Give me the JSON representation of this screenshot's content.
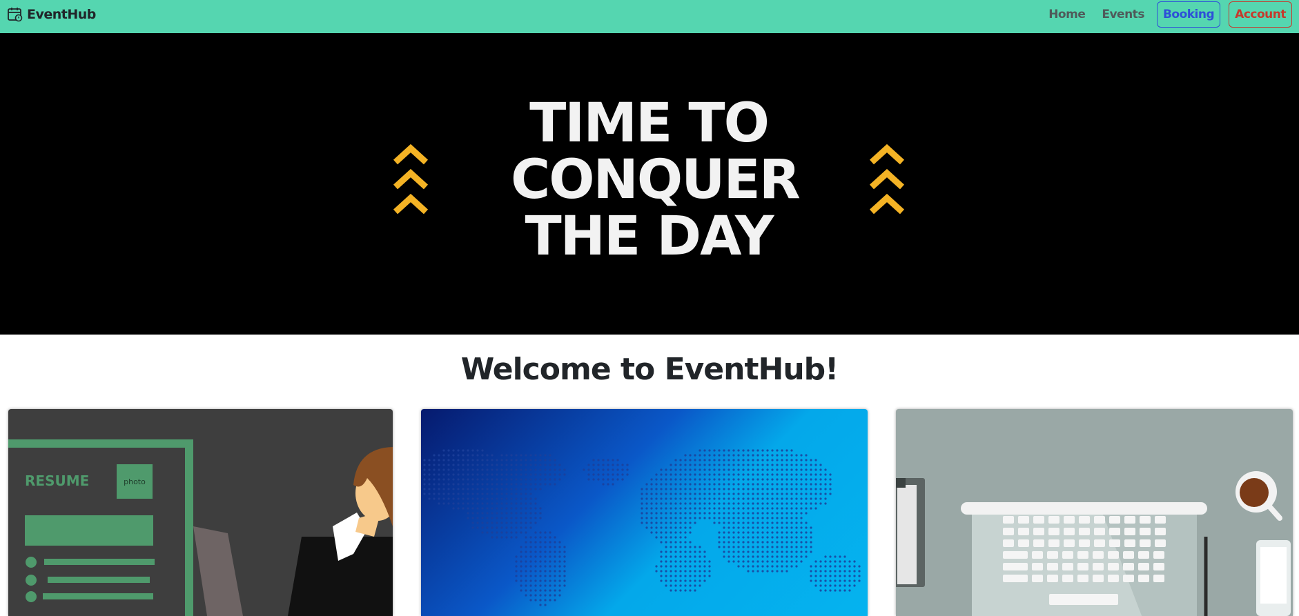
{
  "navbar": {
    "brand": "EventHub",
    "links": {
      "home": "Home",
      "events": "Events"
    },
    "buttons": {
      "booking": "Booking",
      "account": "Account"
    },
    "colors": {
      "background": "#55d6b0",
      "booking": "#2e4fd8",
      "account": "#c6392c"
    }
  },
  "hero": {
    "lines": [
      "TIME TO",
      "CONQUER",
      "THE DAY"
    ],
    "accent_color": "#f4b325"
  },
  "main": {
    "heading": "Welcome to EventHub!"
  },
  "cards": [
    {
      "title": "RESUME",
      "photo_label": "photo"
    },
    {},
    {}
  ]
}
